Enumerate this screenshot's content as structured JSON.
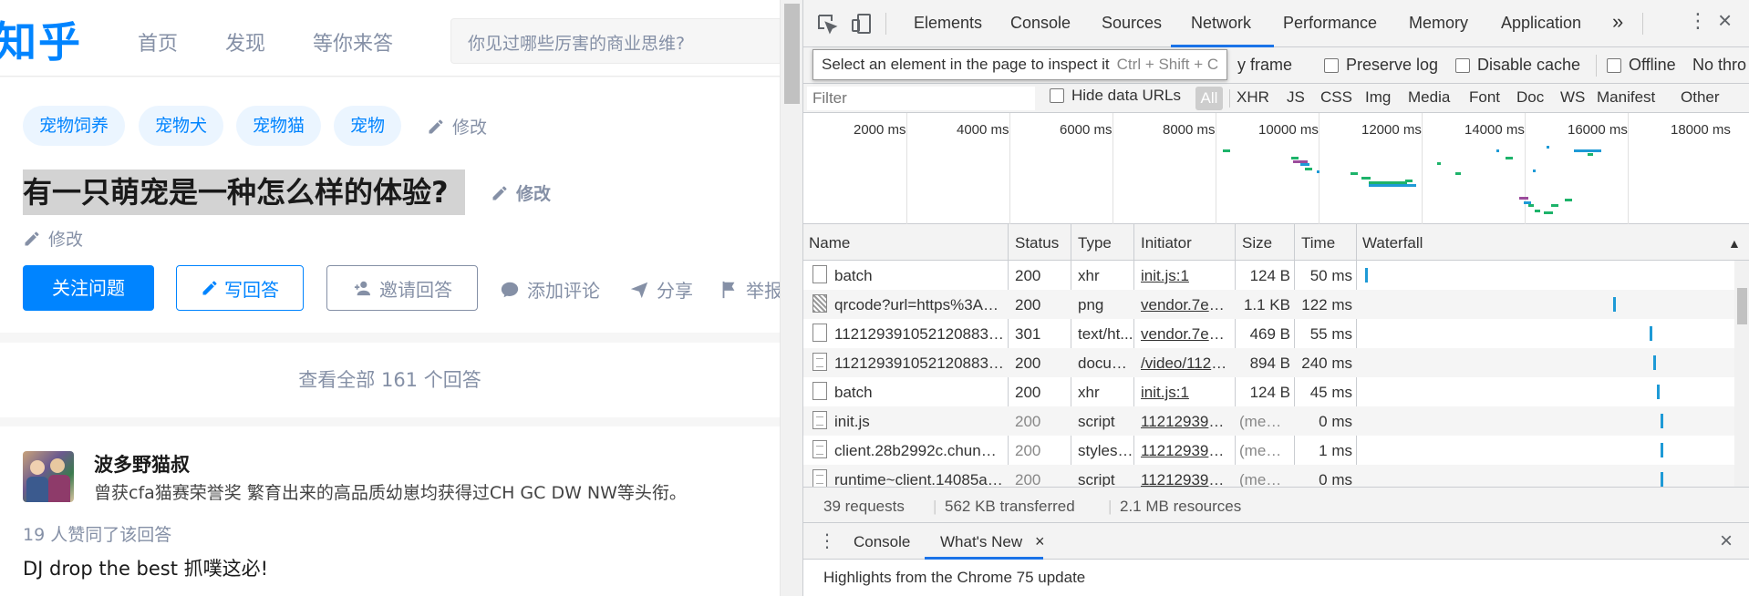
{
  "zhihu": {
    "logo": "知乎",
    "nav": [
      "首页",
      "发现",
      "等你来答"
    ],
    "search_placeholder": "你见过哪些厉害的商业思维?",
    "tags": [
      "宠物饲养",
      "宠物犬",
      "宠物猫",
      "宠物"
    ],
    "edit_label": "修改",
    "question_title": "有一只萌宠是一种怎么样的体验?",
    "follow_button": "关注问题",
    "write_button": "写回答",
    "invite_button": "邀请回答",
    "actions": {
      "comment": "添加评论",
      "share": "分享",
      "report": "举报"
    },
    "view_all": "查看全部 161 个回答",
    "answer": {
      "author": "波多野猫叔",
      "bio": "曾获cfa猫赛荣誉奖 繁育出来的高品质幼崽均获得过CH GC DW NW等头衔。",
      "votes": "19 人赞同了该回答",
      "text": "DJ drop the best 抓噗这必!"
    }
  },
  "devtools": {
    "tabs": [
      "Elements",
      "Console",
      "Sources",
      "Network",
      "Performance",
      "Memory",
      "Application"
    ],
    "active_tab": "Network",
    "more_tabs": "»",
    "tooltip": {
      "text": "Select an element in the page to inspect it",
      "shortcut": "Ctrl + Shift + C"
    },
    "toolbar": {
      "frame_fragment": "y frame",
      "preserve_log": "Preserve log",
      "disable_cache": "Disable cache",
      "offline": "Offline",
      "throttle": "No thro"
    },
    "filter": {
      "placeholder": "Filter",
      "hide_data_urls": "Hide data URLs",
      "all": "All",
      "types": [
        "XHR",
        "JS",
        "CSS",
        "Img",
        "Media",
        "Font",
        "Doc",
        "WS",
        "Manifest",
        "Other"
      ]
    },
    "overview_ticks": [
      "2000 ms",
      "4000 ms",
      "6000 ms",
      "8000 ms",
      "10000 ms",
      "12000 ms",
      "14000 ms",
      "16000 ms",
      "18000 ms"
    ],
    "columns": [
      "Name",
      "Status",
      "Type",
      "Initiator",
      "Size",
      "Time",
      "Waterfall"
    ],
    "sort_indicator": "▲",
    "requests": [
      {
        "name": "batch",
        "status": "200",
        "type": "xhr",
        "initiator": "init.js:1",
        "size": "124 B",
        "time": "50 ms",
        "icon": "blank",
        "dim": false,
        "wf": 0.01
      },
      {
        "name": "qrcode?url=https%3A%2F...",
        "status": "200",
        "type": "png",
        "initiator": "vendor.7e94b...",
        "size": "1.1 KB",
        "time": "122 ms",
        "icon": "img",
        "dim": false,
        "wf": 0.69
      },
      {
        "name": "1121293910521208832?aut...",
        "status": "301",
        "type": "text/ht...",
        "initiator": "vendor.7e94b...",
        "size": "469 B",
        "time": "55 ms",
        "icon": "blank",
        "dim": false,
        "wf": 0.79
      },
      {
        "name": "1121293910521208832?aut...",
        "status": "200",
        "type": "docum...",
        "initiator": "/video/11212...",
        "size": "894 B",
        "time": "240 ms",
        "icon": "doc",
        "dim": false,
        "wf": 0.8
      },
      {
        "name": "batch",
        "status": "200",
        "type": "xhr",
        "initiator": "init.js:1",
        "size": "124 B",
        "time": "45 ms",
        "icon": "blank",
        "dim": false,
        "wf": 0.81
      },
      {
        "name": "init.js",
        "status": "200",
        "type": "script",
        "initiator": "11212939105...",
        "size": "(mem...",
        "time": "0 ms",
        "icon": "doc",
        "dim": true,
        "wf": 0.82
      },
      {
        "name": "client.28b2992c.chunk.css",
        "status": "200",
        "type": "stylesh...",
        "initiator": "11212939105...",
        "size": "(mem...",
        "time": "1 ms",
        "icon": "doc",
        "dim": true,
        "wf": 0.82
      },
      {
        "name": "runtime~client.14085ab2.js",
        "status": "200",
        "type": "script",
        "initiator": "11212939105...",
        "size": "(mem...",
        "time": "0 ms",
        "icon": "doc",
        "dim": true,
        "wf": 0.82
      }
    ],
    "summary": [
      "39 requests",
      "562 KB transferred",
      "2.1 MB resources"
    ],
    "drawer": {
      "tabs": [
        "Console",
        "What's New"
      ],
      "close": "×",
      "body": "Highlights from the Chrome 75 update"
    },
    "close_icon": "×",
    "colors": {
      "accent": "#1a73e8",
      "waterfall": "#1e9ad6",
      "zhihu_blue": "#0084ff"
    }
  }
}
